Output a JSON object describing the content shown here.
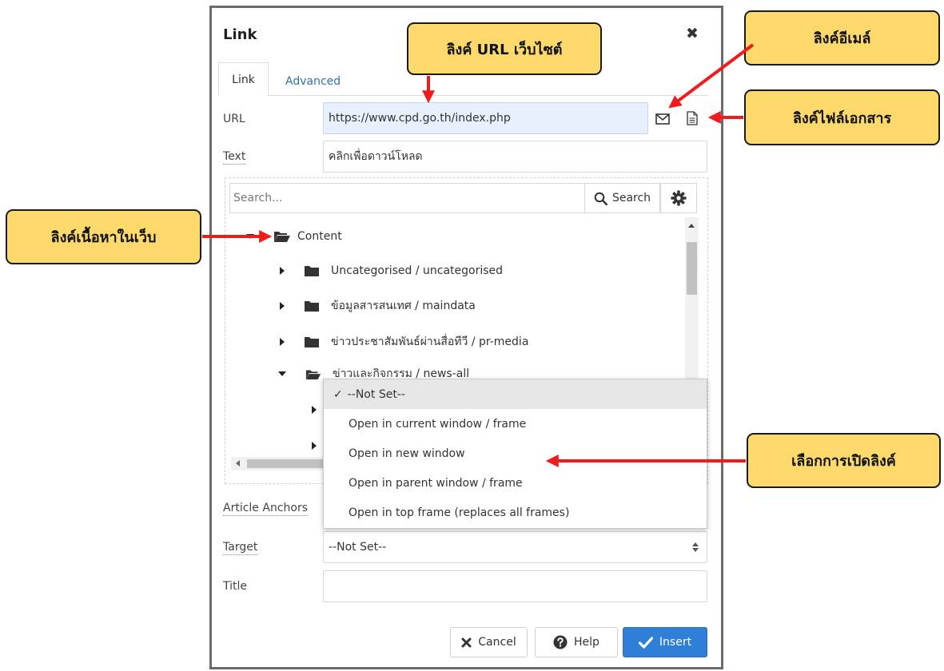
{
  "dialog": {
    "title": "Link",
    "close_glyph": "✖",
    "tabs": [
      {
        "label": "Link",
        "active": true
      },
      {
        "label": "Advanced",
        "active": false
      }
    ]
  },
  "form": {
    "url_label": "URL",
    "url_value": "https://www.cpd.go.th/index.php",
    "text_label": "Text",
    "text_value": "คลิกเพื่อดาวน์โหลด",
    "article_anchors_label": "Article Anchors",
    "target_label": "Target",
    "target_value": "--Not Set--",
    "title_label": "Title",
    "title_value": ""
  },
  "browser": {
    "search_placeholder": "Search...",
    "search_button_label": "Search",
    "tree": {
      "root": "Content",
      "children": [
        "Uncategorised / uncategorised",
        "ข้อมูลสารสนเทศ / maindata",
        "ข่าวประชาสัมพันธ์ผ่านสื่อทีวี / pr-media",
        "ข่าวและกิจกรรม / news-all"
      ]
    }
  },
  "target_dropdown": {
    "check_glyph": "✓",
    "options": [
      "--Not Set--",
      "Open in current window / frame",
      "Open in new window",
      "Open in parent window / frame",
      "Open in top frame (replaces all frames)"
    ],
    "selected_index": 0
  },
  "buttons": {
    "cancel": "Cancel",
    "help": "Help",
    "insert": "Insert"
  },
  "callouts": {
    "url": "ลิงค์ URL เว็บไซต์",
    "email": "ลิงค์อีเมล์",
    "file": "ลิงค์ไฟล์เอกสาร",
    "content": "ลิงค์เนื้อหาในเว็บ",
    "target": "เลือกการเปิดลิงค์"
  },
  "colors": {
    "callout_fill": "#fcd96a",
    "arrow": "#ee1c1c",
    "insert_button": "#2f7ed8",
    "link_tab_text": "#3071a9"
  },
  "icons": [
    "close-icon",
    "mail-icon",
    "file-icon",
    "search-icon",
    "gear-icon",
    "folder-open-icon",
    "folder-icon",
    "caret-right-icon",
    "caret-down-icon",
    "x-icon",
    "question-circle-icon",
    "check-icon",
    "sort-icon"
  ]
}
